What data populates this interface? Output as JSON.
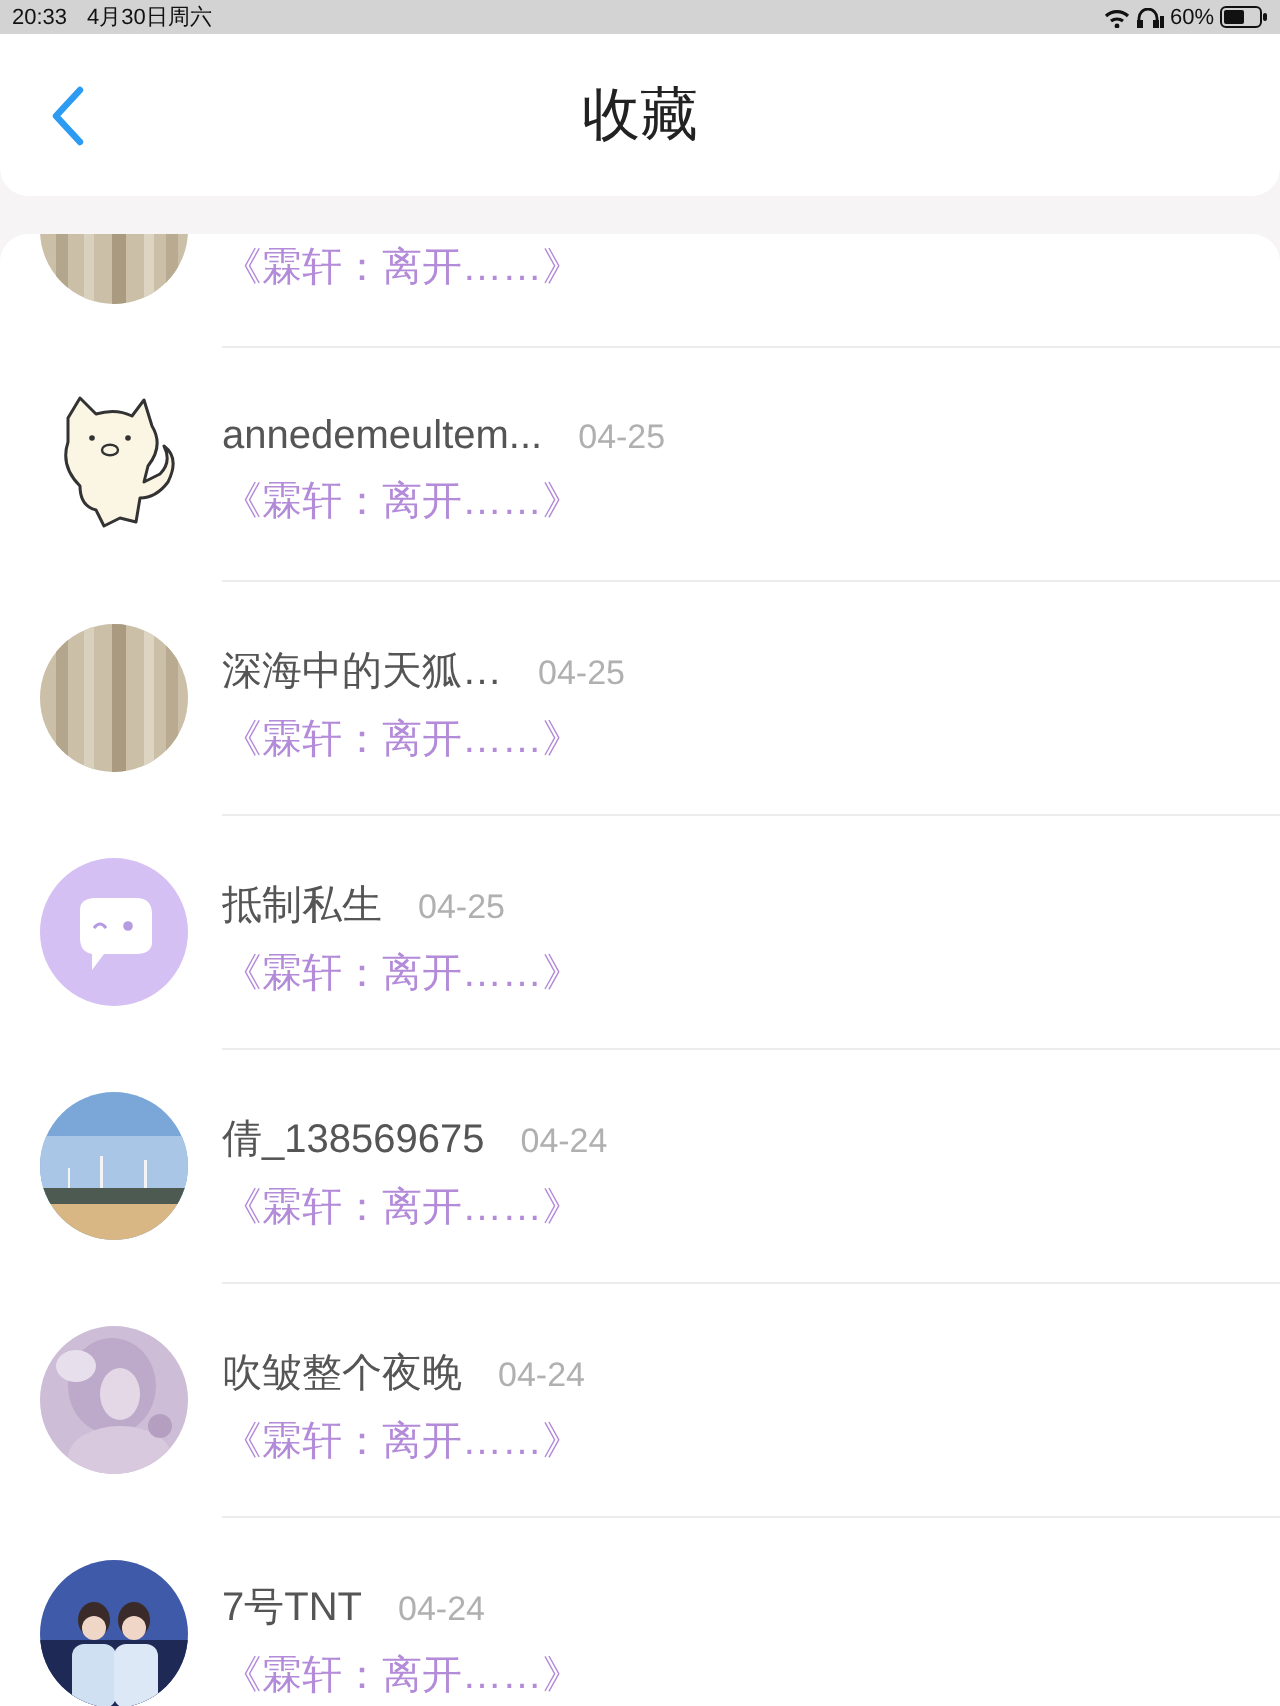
{
  "status_bar": {
    "time": "20:33",
    "date": "4月30日周六",
    "battery": "60%"
  },
  "header": {
    "title": "收藏"
  },
  "items": [
    {
      "subtitle": "《霖轩：离开……》"
    },
    {
      "avatar": {
        "kind": "cat"
      },
      "name": "annedemeultem...",
      "date": "04-25",
      "subtitle": "《霖轩：离开……》"
    },
    {
      "name": "深海中的天狐…",
      "date": "04-25",
      "subtitle": "《霖轩：离开……》"
    },
    {
      "avatar": {
        "kind": "chat"
      },
      "name": "抵制私生",
      "date": "04-25",
      "subtitle": "《霖轩：离开……》"
    },
    {
      "name": "倩_138569675",
      "date": "04-24",
      "subtitle": "《霖轩：离开……》"
    },
    {
      "name": "吹皱整个夜晚",
      "date": "04-24",
      "subtitle": "《霖轩：离开……》"
    },
    {
      "name": "7号TNT",
      "date": "04-24",
      "subtitle": "《霖轩：离开……》"
    }
  ]
}
